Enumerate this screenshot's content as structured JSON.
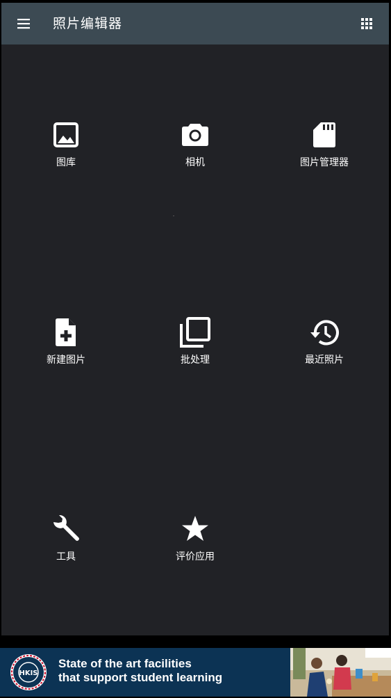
{
  "appbar": {
    "title": "照片编辑器",
    "menu_icon": "menu-icon",
    "apps_icon": "apps-grid-icon",
    "color": "#3c4a53"
  },
  "content": {
    "background": "#212226",
    "tiles": [
      {
        "label": "图库",
        "icon": "image-icon"
      },
      {
        "label": "相机",
        "icon": "camera-icon"
      },
      {
        "label": "图片管理器",
        "icon": "sd-card-icon"
      },
      {
        "label": "新建图片",
        "icon": "new-file-icon"
      },
      {
        "label": "批处理",
        "icon": "layers-icon"
      },
      {
        "label": "最近照片",
        "icon": "history-icon"
      },
      {
        "label": "工具",
        "icon": "wrench-icon"
      },
      {
        "label": "评价应用",
        "icon": "star-icon"
      }
    ]
  },
  "ad": {
    "line1": "State of the art facilities",
    "line2": "that support student learning",
    "logo_text": "HKIS",
    "background": "#0c3354"
  }
}
